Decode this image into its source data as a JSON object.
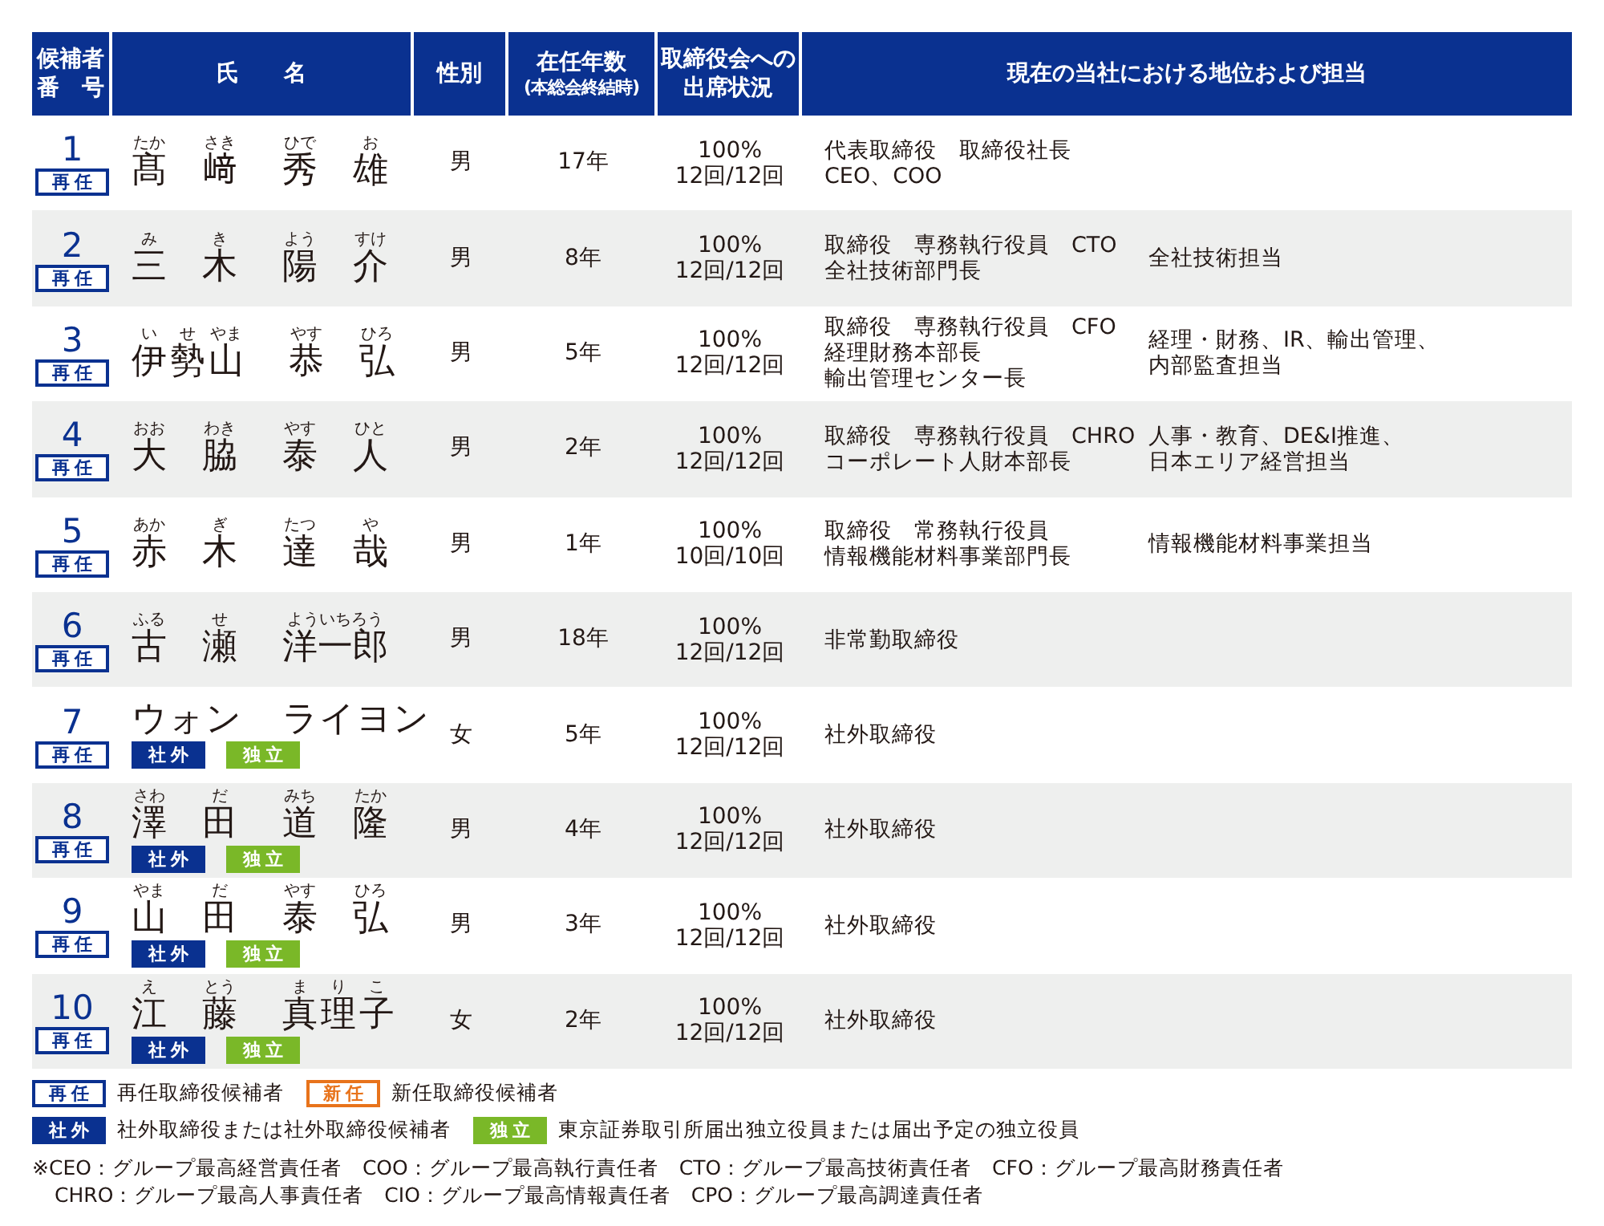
{
  "table": {
    "columns": [
      {
        "lines": [
          "候補者",
          "番　号"
        ]
      },
      {
        "lines": [
          "氏　　名"
        ]
      },
      {
        "lines": [
          "性別"
        ]
      },
      {
        "lines": [
          "在任年数"
        ],
        "note": "(本総会終結時)"
      },
      {
        "lines": [
          "取締役会への",
          "出席状況"
        ]
      },
      {
        "lines": [
          "現在の当社における地位および担当"
        ]
      }
    ],
    "rows": [
      {
        "number": "1",
        "status": {
          "kind": "reappointed",
          "label": "再任"
        },
        "family": [
          {
            "text": "髙",
            "ruby": "たか"
          },
          {
            "text": "﨑",
            "ruby": "さき"
          }
        ],
        "given": [
          {
            "text": "秀",
            "ruby": "ひで"
          },
          {
            "text": "雄",
            "ruby": "お"
          }
        ],
        "gender": "男",
        "tenure": "17年",
        "attendance_rate": "100%",
        "attendance_count": "12回/12回",
        "positions": [
          "代表取締役　取締役社長",
          "CEO、COO"
        ]
      },
      {
        "number": "2",
        "status": {
          "kind": "reappointed",
          "label": "再任"
        },
        "family": [
          {
            "text": "三",
            "ruby": "み"
          },
          {
            "text": "木",
            "ruby": "き"
          }
        ],
        "given": [
          {
            "text": "陽",
            "ruby": "よう"
          },
          {
            "text": "介",
            "ruby": "すけ"
          }
        ],
        "gender": "男",
        "tenure": "8年",
        "attendance_rate": "100%",
        "attendance_count": "12回/12回",
        "positions": [
          "取締役　専務執行役員　CTO",
          "全社技術部門長"
        ],
        "responsibilities": [
          "全社技術担当"
        ]
      },
      {
        "number": "3",
        "status": {
          "kind": "reappointed",
          "label": "再任"
        },
        "family": [
          {
            "text": "伊",
            "ruby": "い"
          },
          {
            "text": "勢",
            "ruby": "せ"
          },
          {
            "text": "山",
            "ruby": "やま"
          }
        ],
        "given": [
          {
            "text": "恭",
            "ruby": "やす"
          },
          {
            "text": "弘",
            "ruby": "ひろ"
          }
        ],
        "gender": "男",
        "tenure": "5年",
        "attendance_rate": "100%",
        "attendance_count": "12回/12回",
        "positions": [
          "取締役　専務執行役員　CFO",
          "経理財務本部長",
          "輸出管理センター長"
        ],
        "responsibilities": [
          "経理・財務、IR、輸出管理、",
          "内部監査担当"
        ]
      },
      {
        "number": "4",
        "status": {
          "kind": "reappointed",
          "label": "再任"
        },
        "family": [
          {
            "text": "大",
            "ruby": "おお"
          },
          {
            "text": "脇",
            "ruby": "わき"
          }
        ],
        "given": [
          {
            "text": "泰",
            "ruby": "やす"
          },
          {
            "text": "人",
            "ruby": "ひと"
          }
        ],
        "gender": "男",
        "tenure": "2年",
        "attendance_rate": "100%",
        "attendance_count": "12回/12回",
        "positions": [
          "取締役　専務執行役員　CHRO",
          "コーポレート人財本部長"
        ],
        "responsibilities": [
          "人事・教育、DE&I推進、",
          "日本エリア経営担当"
        ]
      },
      {
        "number": "5",
        "status": {
          "kind": "reappointed",
          "label": "再任"
        },
        "family": [
          {
            "text": "赤",
            "ruby": "あか"
          },
          {
            "text": "木",
            "ruby": "ぎ"
          }
        ],
        "given": [
          {
            "text": "達",
            "ruby": "たつ"
          },
          {
            "text": "哉",
            "ruby": "や"
          }
        ],
        "gender": "男",
        "tenure": "1年",
        "attendance_rate": "100%",
        "attendance_count": "10回/10回",
        "positions": [
          "取締役　常務執行役員",
          "情報機能材料事業部門長"
        ],
        "responsibilities": [
          "情報機能材料事業担当"
        ]
      },
      {
        "number": "6",
        "status": {
          "kind": "reappointed",
          "label": "再任"
        },
        "family": [
          {
            "text": "古",
            "ruby": "ふる"
          },
          {
            "text": "瀬",
            "ruby": "せ"
          }
        ],
        "given": [
          {
            "text": "洋一郎",
            "ruby": "よういちろう"
          }
        ],
        "gender": "男",
        "tenure": "18年",
        "attendance_rate": "100%",
        "attendance_count": "12回/12回",
        "positions": [
          "非常勤取締役"
        ]
      },
      {
        "number": "7",
        "status": {
          "kind": "reappointed",
          "label": "再任"
        },
        "tags": [
          {
            "kind": "outside",
            "label": "社外"
          },
          {
            "kind": "independent",
            "label": "独立"
          }
        ],
        "family": [
          {
            "text": "ウォン"
          }
        ],
        "given": [
          {
            "text": "ライヨン"
          }
        ],
        "gender": "女",
        "tenure": "5年",
        "attendance_rate": "100%",
        "attendance_count": "12回/12回",
        "positions": [
          "社外取締役"
        ]
      },
      {
        "number": "8",
        "status": {
          "kind": "reappointed",
          "label": "再任"
        },
        "tags": [
          {
            "kind": "outside",
            "label": "社外"
          },
          {
            "kind": "independent",
            "label": "独立"
          }
        ],
        "family": [
          {
            "text": "澤",
            "ruby": "さわ"
          },
          {
            "text": "田",
            "ruby": "だ"
          }
        ],
        "given": [
          {
            "text": "道",
            "ruby": "みち"
          },
          {
            "text": "隆",
            "ruby": "たか"
          }
        ],
        "gender": "男",
        "tenure": "4年",
        "attendance_rate": "100%",
        "attendance_count": "12回/12回",
        "positions": [
          "社外取締役"
        ]
      },
      {
        "number": "9",
        "status": {
          "kind": "reappointed",
          "label": "再任"
        },
        "tags": [
          {
            "kind": "outside",
            "label": "社外"
          },
          {
            "kind": "independent",
            "label": "独立"
          }
        ],
        "family": [
          {
            "text": "山",
            "ruby": "やま"
          },
          {
            "text": "田",
            "ruby": "だ"
          }
        ],
        "given": [
          {
            "text": "泰",
            "ruby": "やす"
          },
          {
            "text": "弘",
            "ruby": "ひろ"
          }
        ],
        "gender": "男",
        "tenure": "3年",
        "attendance_rate": "100%",
        "attendance_count": "12回/12回",
        "positions": [
          "社外取締役"
        ]
      },
      {
        "number": "10",
        "status": {
          "kind": "reappointed",
          "label": "再任"
        },
        "tags": [
          {
            "kind": "outside",
            "label": "社外"
          },
          {
            "kind": "independent",
            "label": "独立"
          }
        ],
        "family": [
          {
            "text": "江",
            "ruby": "え"
          },
          {
            "text": "藤",
            "ruby": "とう"
          }
        ],
        "given": [
          {
            "text": "真",
            "ruby": "ま"
          },
          {
            "text": "理",
            "ruby": "り"
          },
          {
            "text": "子",
            "ruby": "こ"
          }
        ],
        "gender": "女",
        "tenure": "2年",
        "attendance_rate": "100%",
        "attendance_count": "12回/12回",
        "positions": [
          "社外取締役"
        ]
      }
    ]
  },
  "legend": [
    {
      "items": [
        {
          "kind": "reappointed",
          "label": "再任",
          "text": "再任取締役候補者"
        },
        {
          "kind": "new",
          "label": "新任",
          "text": "新任取締役候補者"
        }
      ]
    },
    {
      "items": [
        {
          "kind": "outside",
          "label": "社外",
          "text": "社外取締役または社外取締役候補者"
        },
        {
          "kind": "independent",
          "label": "独立",
          "text": "東京証券取引所届出独立役員または届出予定の独立役員"
        }
      ]
    }
  ],
  "footnotes": [
    "※CEO：グループ最高経営責任者　COO：グループ最高執行責任者　CTO：グループ最高技術責任者　CFO：グループ最高財務責任者",
    "CHRO：グループ最高人事責任者　CIO：グループ最高情報責任者　CPO：グループ最高調達責任者"
  ]
}
